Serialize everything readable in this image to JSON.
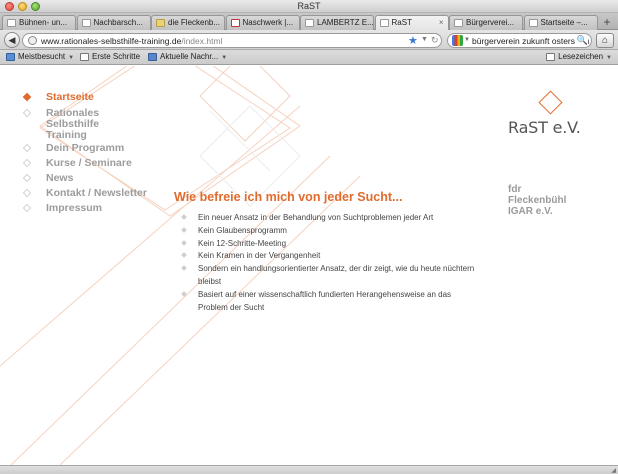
{
  "window": {
    "title": "RaST"
  },
  "tabs": [
    {
      "label": "Bühnen- un...",
      "favicon": "page"
    },
    {
      "label": "Nachbarsch...",
      "favicon": "page"
    },
    {
      "label": "die Fleckenb...",
      "favicon": "yellow"
    },
    {
      "label": "Naschwerk |...",
      "favicon": "red"
    },
    {
      "label": "LAMBERTZ E...",
      "favicon": "page"
    },
    {
      "label": "RaST",
      "favicon": "page",
      "active": true
    },
    {
      "label": "Bürgerverei...",
      "favicon": "page"
    },
    {
      "label": "Startseite –...",
      "favicon": "page"
    }
  ],
  "toolbar": {
    "url_host": "www.rationales-selbsthilfe-training.de",
    "url_path": "/index.html",
    "search_query": "bürgerverein zukunft ostersbau"
  },
  "bookmarks": {
    "items": [
      {
        "label": "Meistbesucht",
        "icon": "blue",
        "dropdown": true
      },
      {
        "label": "Erste Schritte",
        "icon": "page",
        "dropdown": false
      },
      {
        "label": "Aktuelle Nachr...",
        "icon": "rss",
        "dropdown": true
      }
    ],
    "right_label": "Lesezeichen"
  },
  "site": {
    "nav": [
      {
        "label": "Startseite",
        "active": true
      },
      {
        "label": "Rationales\nSelbsthilfe\nTraining",
        "active": false
      },
      {
        "label": "Dein Programm",
        "active": false
      },
      {
        "label": "Kurse / Seminare",
        "active": false
      },
      {
        "label": "News",
        "active": false
      },
      {
        "label": "Kontakt / Newsletter",
        "active": false
      },
      {
        "label": "Impressum",
        "active": false
      }
    ],
    "logo_text": "RaST e.V.",
    "partners": [
      "fdr",
      "Fleckenbühl",
      "IGAR e.V."
    ],
    "headline": "Wie befreie ich mich von jeder Sucht...",
    "bullets": [
      "Ein neuer Ansatz in der Behandlung von Suchtproblemen jeder Art",
      "Kein Glaubensprogramm",
      "Kein 12-Schritte-Meeting",
      "Kein Kramen in der Vergangenheit",
      "Sondern ein handlungsorientierter Ansatz, der dir zeigt, wie du heute nüchtern bleibst",
      "Basiert auf einer wissenschaftlich fundierten Herangehensweise an das Problem der Sucht"
    ],
    "accent_color": "#e06b2d"
  }
}
